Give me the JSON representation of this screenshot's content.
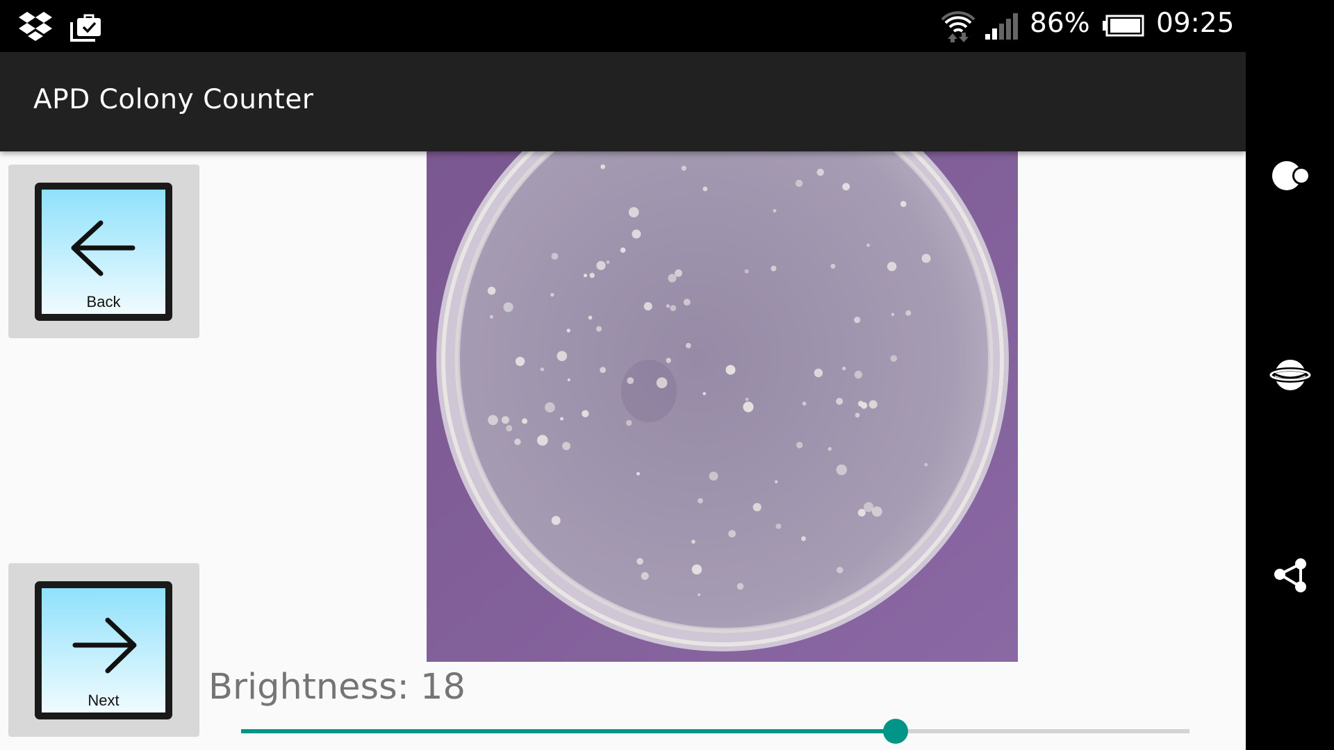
{
  "status_bar": {
    "notification_icons": [
      "dropbox-icon",
      "work-briefcase-check-icon"
    ],
    "wifi_icon": "wifi-data-icon",
    "signal_icon": "cell-signal-icon",
    "battery_percent": "86%",
    "battery_icon": "battery-icon",
    "time": "09:25"
  },
  "app_bar": {
    "title": "APD Colony Counter"
  },
  "controls": {
    "back_label": "Back",
    "next_label": "Next",
    "brightness_label": "Brightness: 18",
    "brightness_value": 18,
    "brightness_slider_fraction": 0.69
  },
  "image": {
    "description": "Petri dish with bacterial colonies on purple background"
  },
  "colors": {
    "app_bar": "#212121",
    "accent": "#009587",
    "tile_gradient_top": "#8fe1fb",
    "tile_gradient_bottom": "#f0fbff",
    "photo_background": "#7a5790"
  },
  "nav_bar": {
    "buttons": [
      "back",
      "home",
      "recents"
    ]
  }
}
